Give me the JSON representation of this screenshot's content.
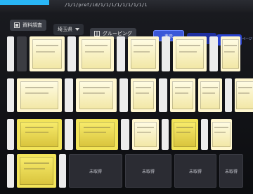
{
  "address_bar": {
    "text": "/1/1/pref/id/1/1/1/1/1/1/1/1/1"
  },
  "toolbar": {
    "search_label": "資料調査",
    "prefecture_value": "埼玉県",
    "grouping_label": "グルーピング",
    "tabs": [
      {
        "label": "表示"
      },
      {
        "label": "検索"
      },
      {
        "label": "保存"
      }
    ],
    "edge_text": "ページ"
  },
  "thumbnails": {
    "unloaded_label": "未取得"
  }
}
